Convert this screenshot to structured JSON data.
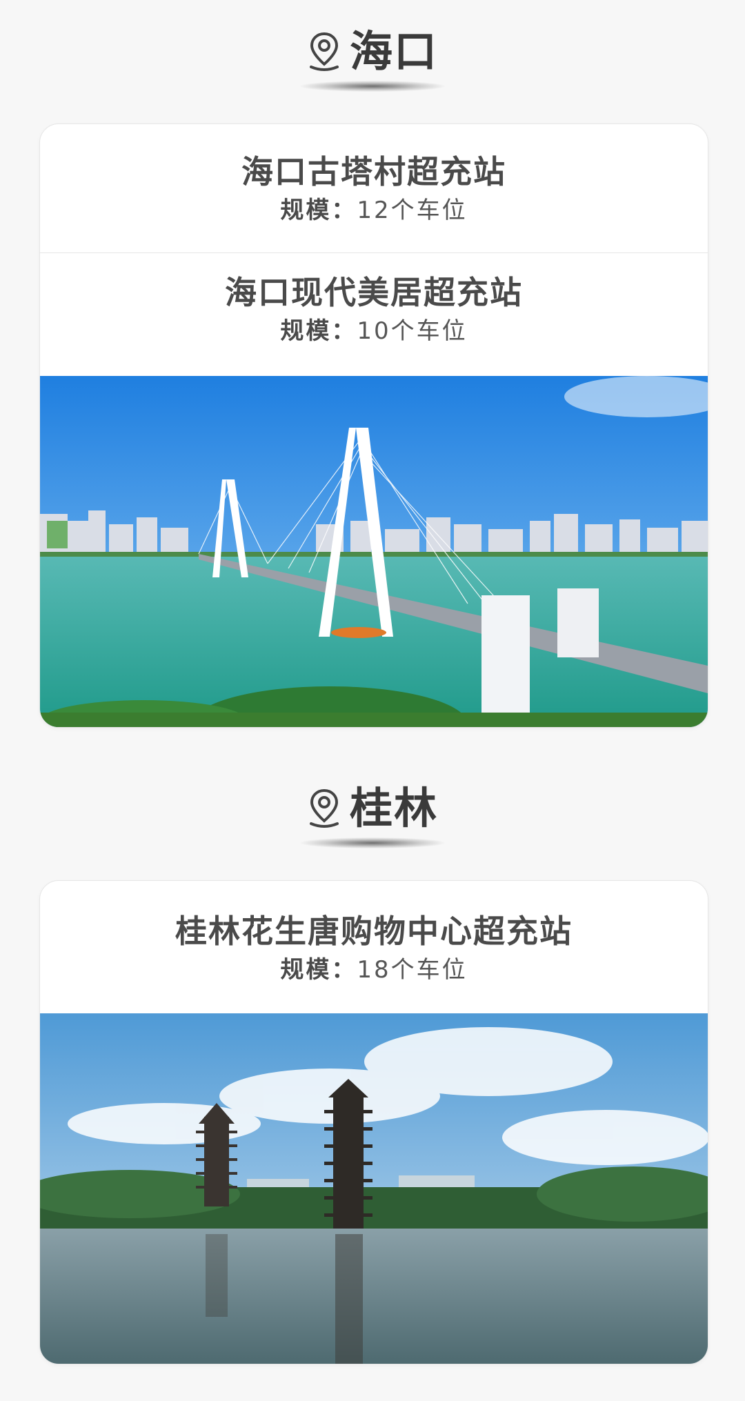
{
  "sections": [
    {
      "city": "海口",
      "stations": [
        {
          "name": "海口古塔村超充站",
          "capacity_label": "规模：",
          "capacity_value": "12个车位"
        },
        {
          "name": "海口现代美居超充站",
          "capacity_label": "规模：",
          "capacity_value": "10个车位"
        }
      ]
    },
    {
      "city": "桂林",
      "stations": [
        {
          "name": "桂林花生唐购物中心超充站",
          "capacity_label": "规模：",
          "capacity_value": "18个车位"
        }
      ]
    }
  ],
  "icons": {
    "location": "location-pin-icon"
  },
  "colors": {
    "background": "#f7f7f7",
    "card": "#ffffff",
    "text": "#4a4a4a",
    "sky": "#2e8fe0",
    "water": "#2fa89a"
  }
}
